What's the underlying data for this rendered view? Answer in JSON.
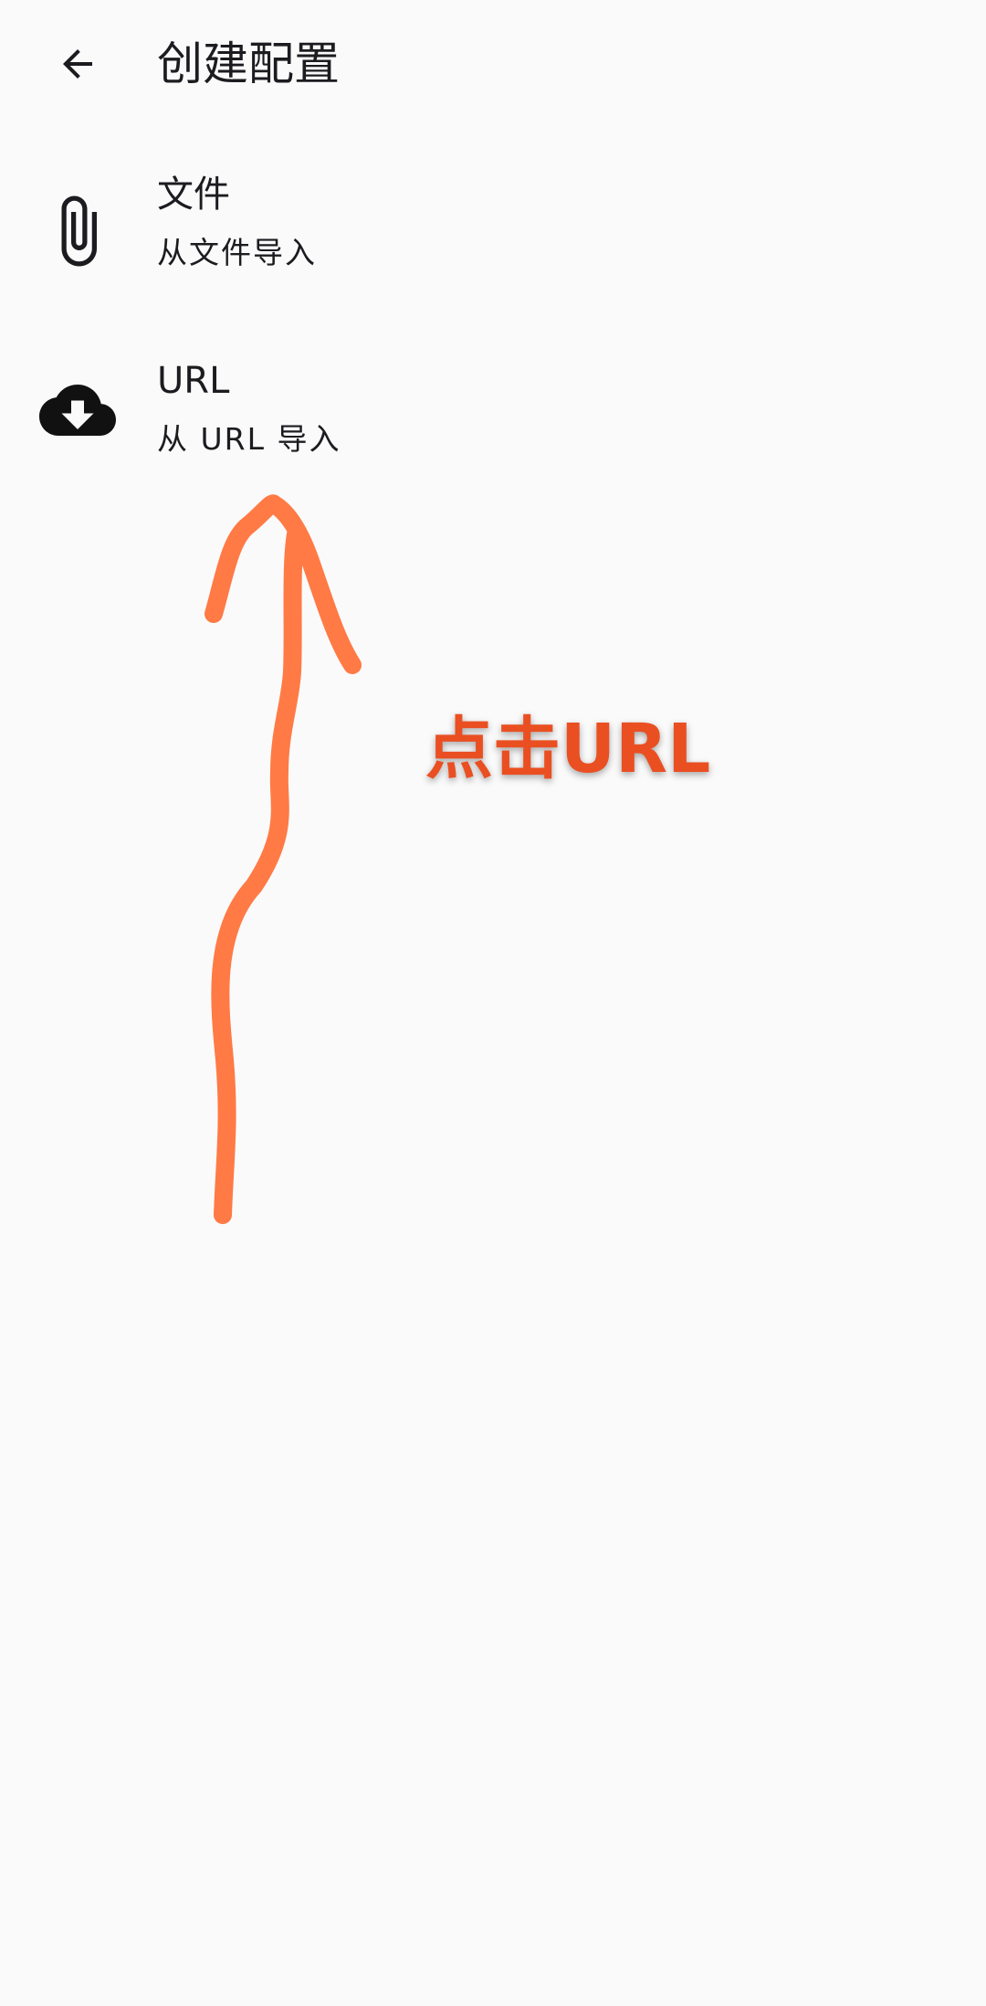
{
  "app_bar": {
    "back_icon": "arrow-back-icon",
    "title": "创建配置"
  },
  "options": [
    {
      "icon": "paperclip-icon",
      "title": "文件",
      "subtitle": "从文件导入"
    },
    {
      "icon": "cloud-download-icon",
      "title": "URL",
      "subtitle": "从 URL 导入"
    }
  ],
  "annotation": {
    "text": "点击URL",
    "arrow_color": "#ff7a45",
    "text_color": "#ea4f22"
  },
  "colors": {
    "background": "#fafafa",
    "text": "#1c1b1f"
  }
}
